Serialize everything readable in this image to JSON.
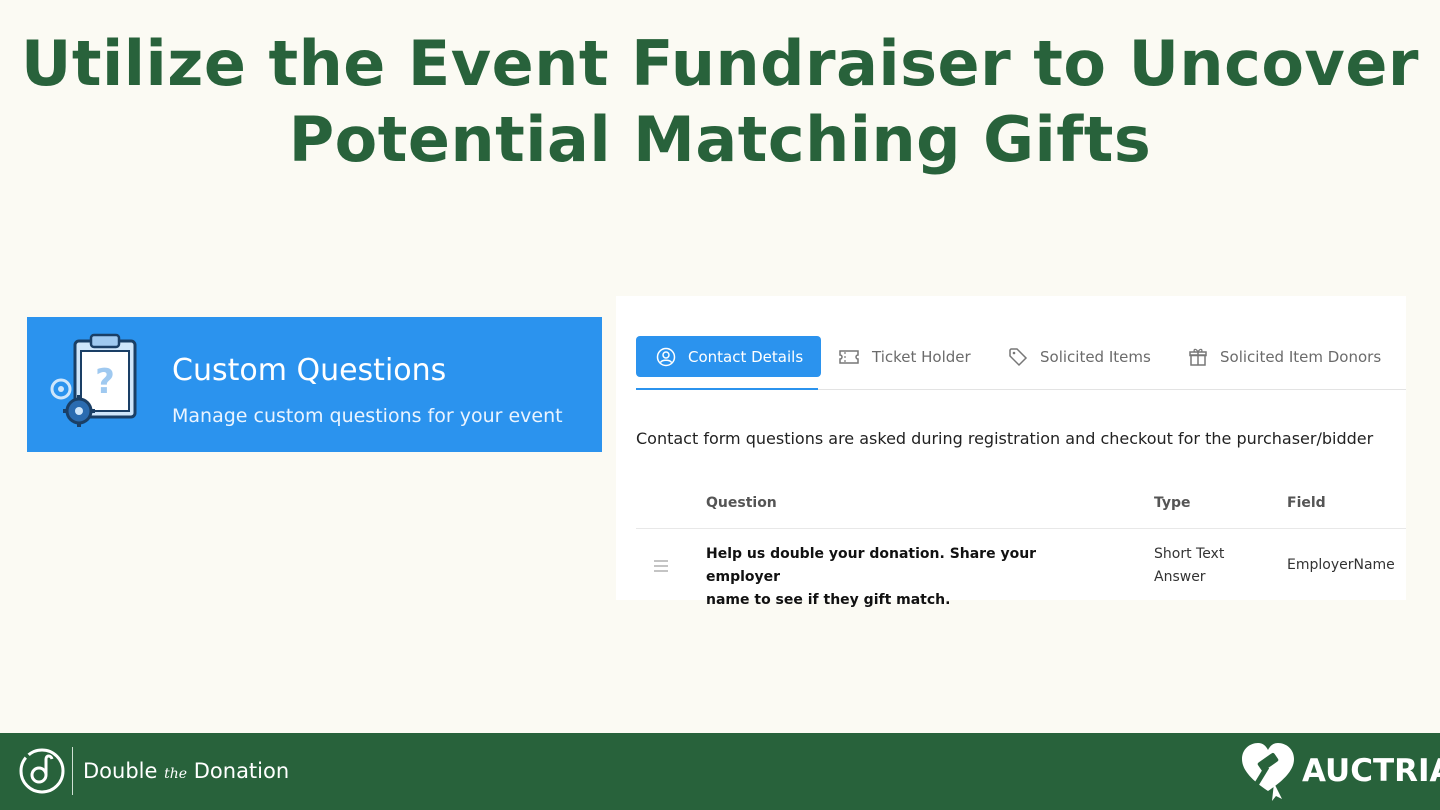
{
  "slide": {
    "title_line1": "Utilize the Event Fundraiser to Uncover",
    "title_line2": "Potential Matching Gifts"
  },
  "banner": {
    "icon": "clipboard-question-gear-icon",
    "title": "Custom Questions",
    "subtitle": "Manage custom questions for your event"
  },
  "tabs": [
    {
      "label": "Contact Details",
      "icon": "user-circle-icon",
      "active": true
    },
    {
      "label": "Ticket Holder",
      "icon": "ticket-icon",
      "active": false
    },
    {
      "label": "Solicited Items",
      "icon": "tag-icon",
      "active": false
    },
    {
      "label": "Solicited Item Donors",
      "icon": "gift-icon",
      "active": false
    }
  ],
  "description": "Contact form questions are asked during registration and checkout for the purchaser/bidder",
  "table": {
    "headers": [
      "Question",
      "Type",
      "Field"
    ],
    "rows": [
      {
        "question_line1": "Help us double your donation. Share your employer",
        "question_line2": "name to see if they gift match.",
        "type_line1": "Short Text",
        "type_line2": "Answer",
        "field": "EmployerName"
      }
    ]
  },
  "footer": {
    "left_brand_prefix": "Double",
    "left_brand_the": "the",
    "left_brand_suffix": "Donation",
    "right_brand": "AUCTRIA"
  },
  "colors": {
    "brand_green": "#28623b",
    "accent_blue": "#2b93ee",
    "background": "#fbfaf3"
  }
}
